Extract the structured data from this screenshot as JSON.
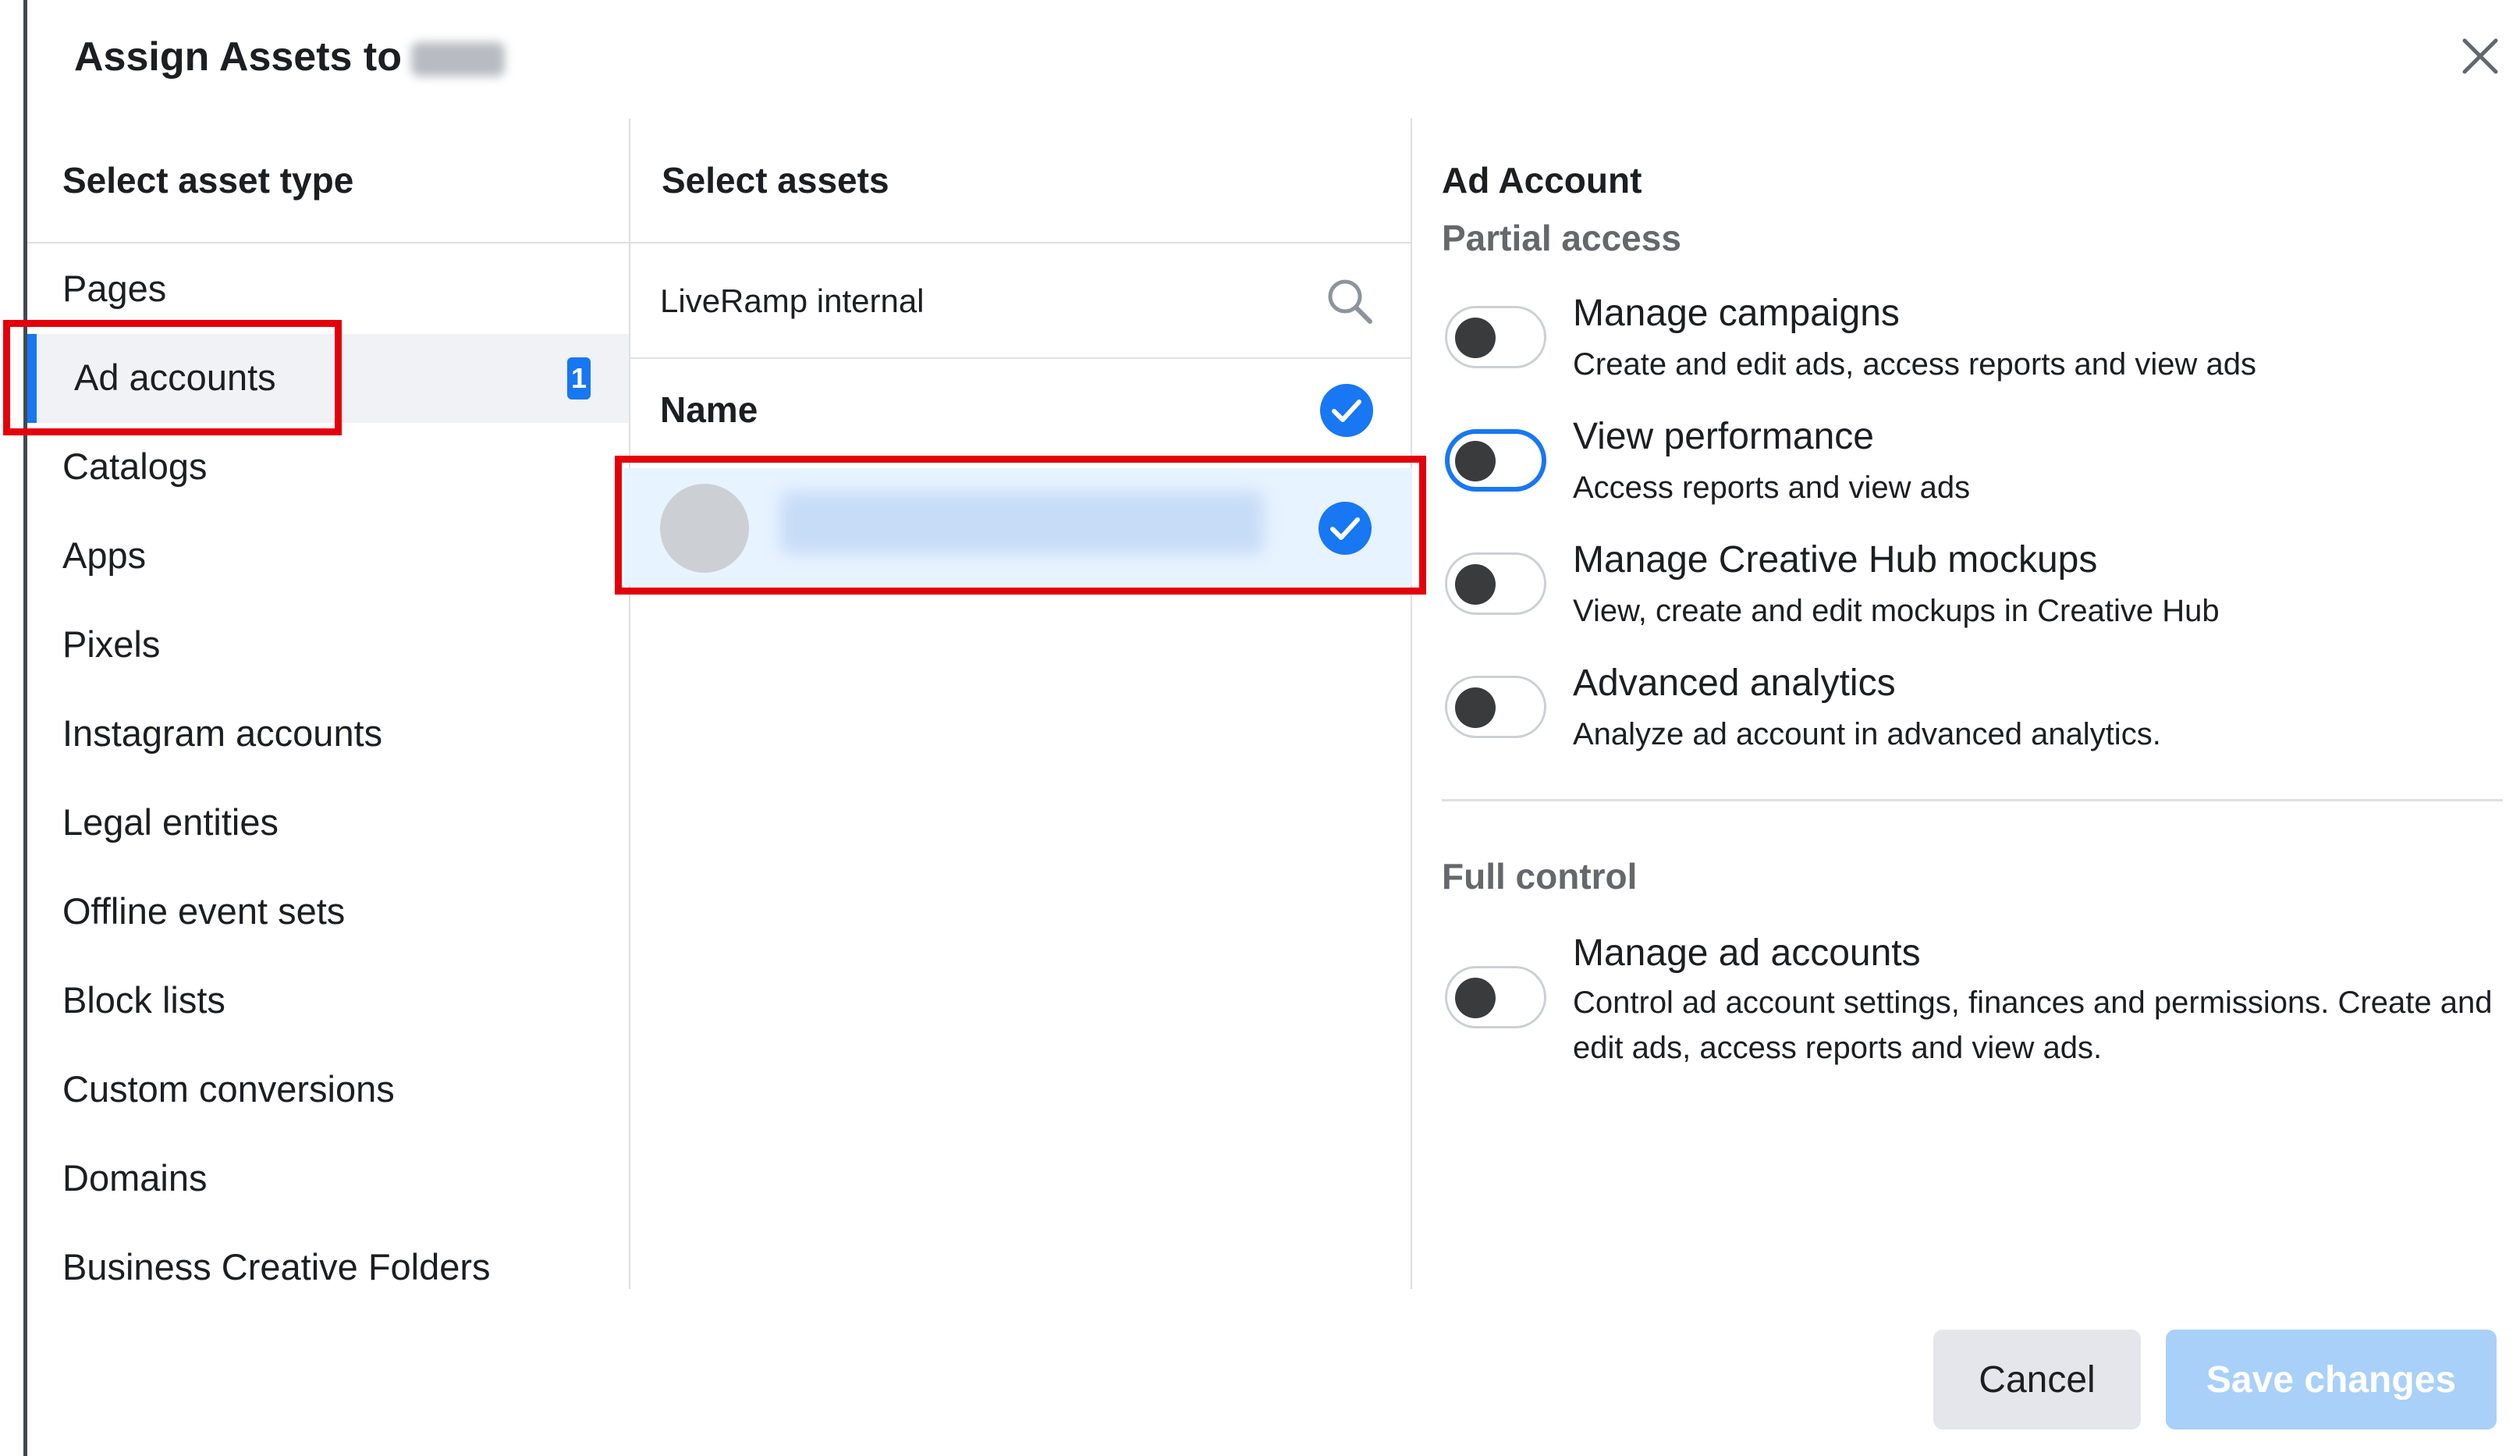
{
  "dialog": {
    "title": "Assign Assets to",
    "close_icon": "close-icon"
  },
  "asset_types": {
    "heading": "Select asset type",
    "items": [
      {
        "label": "Pages"
      },
      {
        "label": "Ad accounts",
        "selected": true,
        "count": "1"
      },
      {
        "label": "Catalogs"
      },
      {
        "label": "Apps"
      },
      {
        "label": "Pixels"
      },
      {
        "label": "Instagram accounts"
      },
      {
        "label": "Legal entities"
      },
      {
        "label": "Offline event sets"
      },
      {
        "label": "Block lists"
      },
      {
        "label": "Custom conversions"
      },
      {
        "label": "Domains"
      },
      {
        "label": "Business Creative Folders"
      }
    ]
  },
  "assets": {
    "heading": "Select assets",
    "search": {
      "value": "LiveRamp internal",
      "icon": "search-icon"
    },
    "column_header": "Name",
    "rows": [
      {
        "checked": true
      }
    ]
  },
  "permissions": {
    "heading": "Ad Account",
    "partial_label": "Partial access",
    "partial": [
      {
        "title": "Manage campaigns",
        "description": "Create and edit ads, access reports and view ads",
        "on": false
      },
      {
        "title": "View performance",
        "description": "Access reports and view ads",
        "on": false,
        "focused": true
      },
      {
        "title": "Manage Creative Hub mockups",
        "description": "View, create and edit mockups in Creative Hub",
        "on": false
      },
      {
        "title": "Advanced analytics",
        "description": "Analyze ad account in advanced analytics.",
        "on": false
      }
    ],
    "full_label": "Full control",
    "full": [
      {
        "title": "Manage ad accounts",
        "description": "Control ad account settings, finances and permissions. Create and edit ads, access reports and view ads.",
        "on": false
      }
    ]
  },
  "footer": {
    "cancel_label": "Cancel",
    "save_label": "Save changes"
  },
  "colors": {
    "accent": "#1877f2",
    "annotation": "#e3000b",
    "save_disabled": "#a9d0f8"
  }
}
